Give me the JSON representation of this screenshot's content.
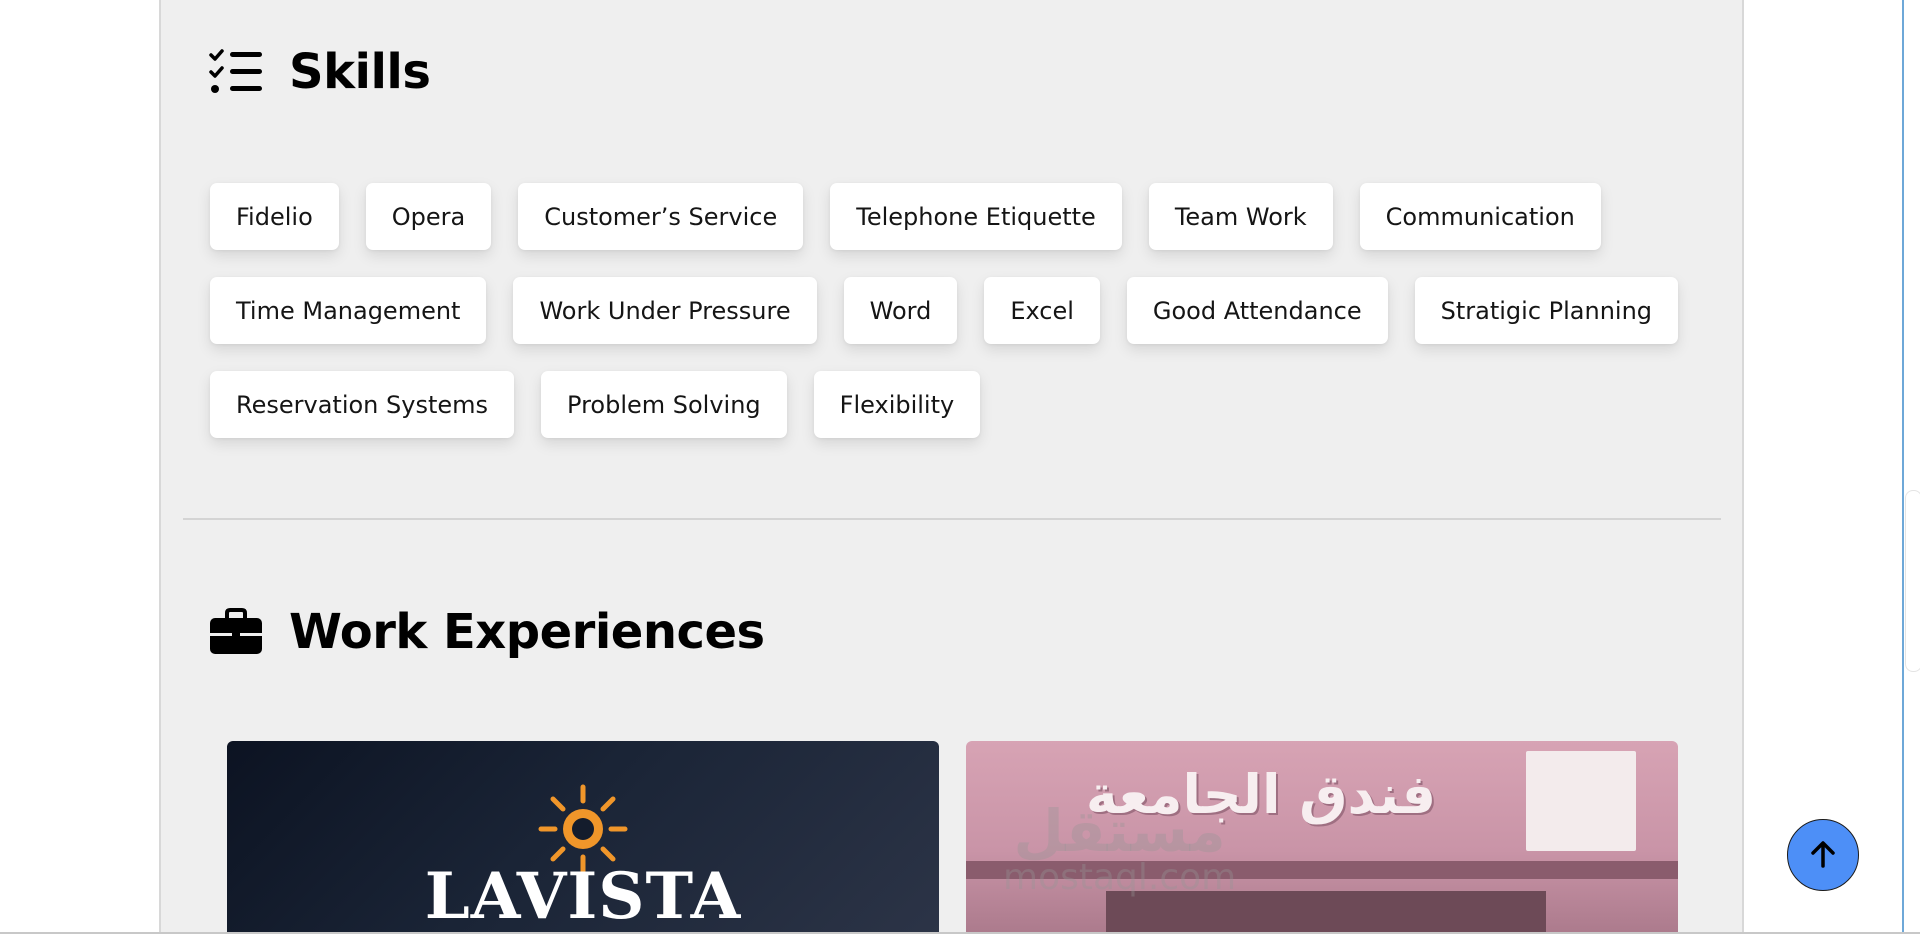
{
  "skills": {
    "title": "Skills",
    "icon": "list-check-icon",
    "items": [
      "Fidelio",
      "Opera",
      "Customer’s Service",
      "Telephone Etiquette",
      "Team Work",
      "Communication",
      "Time Management",
      "Work Under Pressure",
      "Word",
      "Excel",
      "Good Attendance",
      "Stratigic Planning",
      "Reservation Systems",
      "Problem Solving",
      "Flexibility"
    ]
  },
  "work": {
    "title": "Work Experiences",
    "icon": "briefcase-icon",
    "cards": [
      {
        "logo_text": "LAVISTA",
        "logo_icon": "sun-icon"
      },
      {
        "sign_text": "فندق الجامعة"
      }
    ]
  },
  "watermark": {
    "arabic": "مستقل",
    "latin": "mostaql.com"
  },
  "scroll_top": {
    "icon": "arrow-up-icon"
  },
  "colors": {
    "panel_bg": "#efefef",
    "chip_bg": "#ffffff",
    "scroll_button": "#4d8ff7",
    "lavista_sun": "#f0962a"
  }
}
